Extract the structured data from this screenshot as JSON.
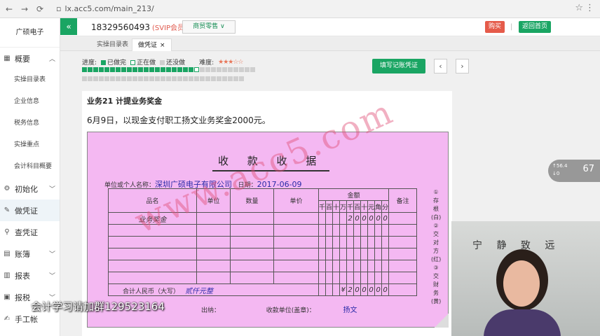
{
  "browser": {
    "url": "lx.acc5.com/main_213/"
  },
  "sidebar": {
    "company": "广硕电子",
    "sections": [
      {
        "label": "概要",
        "icon": "grid-icon",
        "arrow": "up"
      },
      {
        "label": "初始化",
        "icon": "gear-icon",
        "arrow": "down"
      },
      {
        "label": "做凭证",
        "icon": "pencil-icon",
        "arrow": ""
      },
      {
        "label": "查凭证",
        "icon": "search-icon",
        "arrow": ""
      },
      {
        "label": "账簿",
        "icon": "book-icon",
        "arrow": "down"
      },
      {
        "label": "报表",
        "icon": "report-icon",
        "arrow": "down"
      },
      {
        "label": "报税",
        "icon": "tax-icon",
        "arrow": "down"
      },
      {
        "label": "手工帐",
        "icon": "ledger-icon",
        "arrow": ""
      }
    ],
    "sub_items": [
      "实操目录表",
      "企业信息",
      "税务信息",
      "实操重点",
      "会计科目概要"
    ]
  },
  "topbar": {
    "phone": "18329560493",
    "vip": "(SVIP会员)",
    "mode": "商贸零售",
    "buy": "购买",
    "back": "返回首页"
  },
  "tabs": [
    {
      "label": "实操目录表"
    },
    {
      "label": "做凭证",
      "close": "×"
    }
  ],
  "progress": {
    "label": "进度:",
    "done": "已做完",
    "doing": "正在做",
    "todo": "还没做",
    "difficulty": "难度:",
    "total": 60,
    "done_count": 20,
    "current": 21
  },
  "fill_button": "填写记账凭证",
  "task": {
    "title": "业务21 计提业务奖金",
    "desc": "6月9日，以现金支付职工扬文业务奖金2000元。"
  },
  "receipt": {
    "title": "收 款 收 据",
    "payer_label": "单位或个人名称：",
    "payer": "深圳广硕电子有限公司",
    "date_label": "日期：",
    "date": "2017-06-09",
    "headers": {
      "name": "品名",
      "unit": "单位",
      "qty": "数量",
      "price": "单价",
      "amount": "金额",
      "note": "备注"
    },
    "digits": [
      "千",
      "百",
      "十",
      "万",
      "千",
      "百",
      "十",
      "元",
      "角",
      "分"
    ],
    "row1_name": "业务奖金",
    "row1_digits": [
      "",
      "",
      "",
      "",
      "2",
      "0",
      "0",
      "0",
      "0",
      "0"
    ],
    "total_label": "合计人民币（大写）",
    "total_cn": "贰仟元整",
    "total_digits": [
      "",
      "",
      "",
      "¥",
      "2",
      "0",
      "0",
      "0",
      "0",
      "0"
    ],
    "cashier_label": "出纳：",
    "payee_label": "收款单位(盖章)：",
    "payee": "扬文",
    "side_note": [
      "①",
      "存",
      "根",
      "(白)",
      "②",
      "交",
      "对",
      "方",
      "(红)",
      "③",
      "交",
      "财",
      "务",
      "(黄)"
    ],
    "watermark": "www.acc5.com"
  },
  "overlay_text": "会计学习请加群129523164",
  "video": {
    "calligraphy": "宁 静 致 远"
  },
  "gauge": {
    "percent": "67",
    "up": "56.4",
    "down": "0"
  },
  "colors": {
    "accent": "#1aa563",
    "receipt_bg": "#f4b8f2",
    "buy": "#e55b4a"
  }
}
